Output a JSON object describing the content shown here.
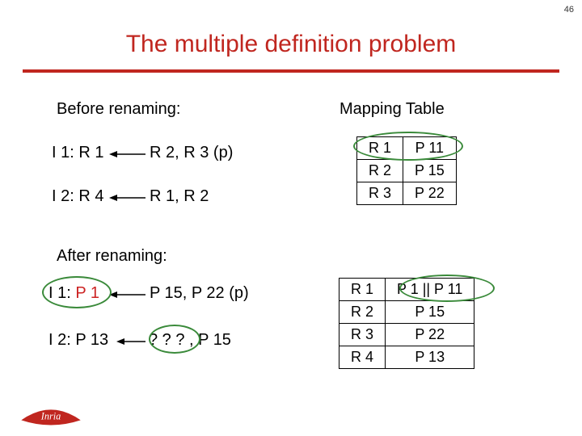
{
  "page_number": "46",
  "title": "The multiple definition problem",
  "labels": {
    "before": "Before renaming:",
    "mapping": "Mapping Table",
    "after": "After renaming:"
  },
  "before": {
    "i1_lhs": "I 1: R 1",
    "i1_rhs": "R 2, R 3 (p)",
    "i2_lhs": "I 2: R 4",
    "i2_rhs": "R 1, R 2"
  },
  "after": {
    "i1_lhs_a": "I 1: ",
    "i1_lhs_b": "P 1",
    "i1_rhs": "P 15, P 22 (p)",
    "i2_lhs": "I 2: P 13",
    "i2_rhs": " ? ? ? , P 15"
  },
  "map1": {
    "r1": "R 1",
    "p11": "P 11",
    "r2": "R 2",
    "p15": "P 15",
    "r3": "R 3",
    "p22": "P 22"
  },
  "map2": {
    "r1": "R 1",
    "p1p11": "P 1 || P 11",
    "r2": "R 2",
    "p15": "P 15",
    "r3": "R 3",
    "p22": "P 22",
    "r4": "R 4",
    "p13": "P 13"
  },
  "logo_text": "Inria"
}
